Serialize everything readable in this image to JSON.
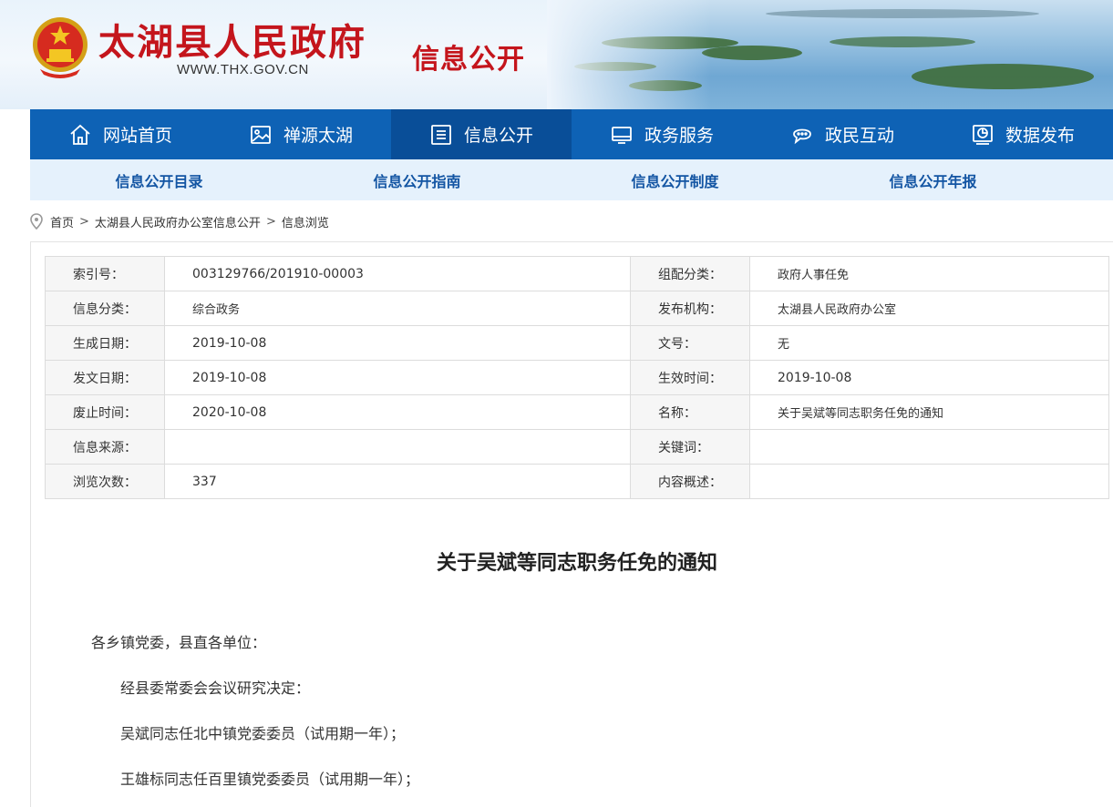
{
  "header": {
    "site_title": "太湖县人民政府",
    "site_url": "WWW.THX.GOV.CN",
    "section_title": "信息公开"
  },
  "main_nav": [
    {
      "label": "网站首页",
      "icon": "home-icon"
    },
    {
      "label": "禅源太湖",
      "icon": "picture-icon"
    },
    {
      "label": "信息公开",
      "icon": "list-icon",
      "active": true
    },
    {
      "label": "政务服务",
      "icon": "monitor-icon"
    },
    {
      "label": "政民互动",
      "icon": "chat-icon"
    },
    {
      "label": "数据发布",
      "icon": "chart-icon"
    }
  ],
  "sub_nav": [
    "信息公开目录",
    "信息公开指南",
    "信息公开制度",
    "信息公开年报"
  ],
  "breadcrumb": {
    "home": "首页",
    "sep1": ">",
    "unit": "太湖县人民政府办公室信息公开",
    "sep2": ">",
    "current": "信息浏览"
  },
  "meta": {
    "rows": [
      {
        "l_label": "索引号：",
        "l_value": "003129766/201910-00003",
        "r_label": "组配分类：",
        "r_value": "政府人事任免"
      },
      {
        "l_label": "信息分类：",
        "l_value": "综合政务",
        "r_label": "发布机构：",
        "r_value": "太湖县人民政府办公室"
      },
      {
        "l_label": "生成日期：",
        "l_value": "2019-10-08",
        "r_label": "文号：",
        "r_value": "无"
      },
      {
        "l_label": "发文日期：",
        "l_value": "2019-10-08",
        "r_label": "生效时间：",
        "r_value": "2019-10-08"
      },
      {
        "l_label": "废止时间：",
        "l_value": "2020-10-08",
        "r_label": "名称：",
        "r_value": "关于吴斌等同志职务任免的通知"
      },
      {
        "l_label": "信息来源：",
        "l_value": "",
        "r_label": "关键词：",
        "r_value": ""
      },
      {
        "l_label": "浏览次数：",
        "l_value": "337",
        "r_label": "内容概述：",
        "r_value": ""
      }
    ]
  },
  "article": {
    "title": "关于吴斌等同志职务任免的通知",
    "salutation": "各乡镇党委，县直各单位：",
    "paragraphs": [
      "经县委常委会会议研究决定：",
      "吴斌同志任北中镇党委委员（试用期一年）；",
      "王雄标同志任百里镇党委委员（试用期一年）；"
    ]
  },
  "colors": {
    "brand_red": "#c4151c",
    "nav_blue": "#0e62b5",
    "nav_active": "#094e98",
    "subnav_bg": "#e5f1fc",
    "subnav_text": "#1355a3"
  }
}
